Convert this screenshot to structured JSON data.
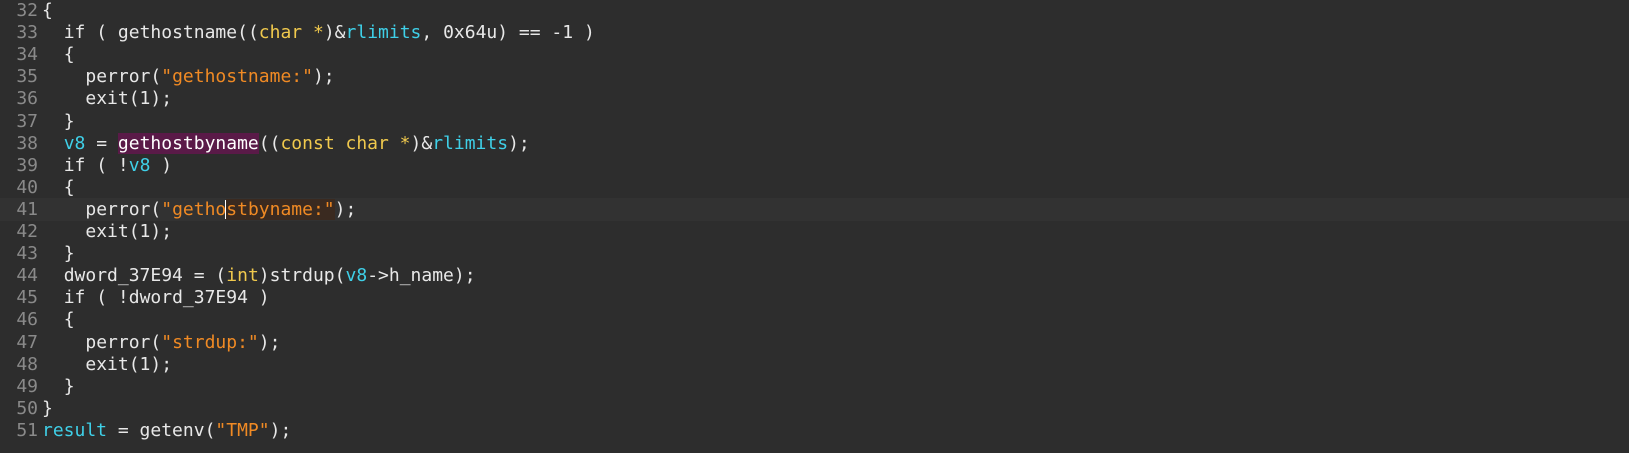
{
  "editor": {
    "lines": [
      {
        "num": "32",
        "indent": "",
        "parts": [
          {
            "t": "{",
            "c": "op"
          }
        ]
      },
      {
        "num": "33",
        "indent": "  ",
        "parts": [
          {
            "t": "if",
            "c": "kw"
          },
          {
            "t": " ( ",
            "c": "op"
          },
          {
            "t": "gethostname",
            "c": "fn"
          },
          {
            "t": "((",
            "c": "op"
          },
          {
            "t": "char *",
            "c": "type"
          },
          {
            "t": ")&",
            "c": "op"
          },
          {
            "t": "rlimits",
            "c": "var"
          },
          {
            "t": ", ",
            "c": "op"
          },
          {
            "t": "0x64u",
            "c": "num"
          },
          {
            "t": ") == -1 )",
            "c": "op"
          }
        ]
      },
      {
        "num": "34",
        "indent": "  ",
        "parts": [
          {
            "t": "{",
            "c": "op"
          }
        ]
      },
      {
        "num": "35",
        "indent": "    ",
        "parts": [
          {
            "t": "perror",
            "c": "fn"
          },
          {
            "t": "(",
            "c": "op"
          },
          {
            "t": "\"gethostname:\"",
            "c": "str"
          },
          {
            "t": ");",
            "c": "op"
          }
        ]
      },
      {
        "num": "36",
        "indent": "    ",
        "parts": [
          {
            "t": "exit",
            "c": "fn"
          },
          {
            "t": "(1);",
            "c": "op"
          }
        ]
      },
      {
        "num": "37",
        "indent": "  ",
        "parts": [
          {
            "t": "}",
            "c": "op"
          }
        ]
      },
      {
        "num": "38",
        "indent": "  ",
        "parts": [
          {
            "t": "v8",
            "c": "var"
          },
          {
            "t": " = ",
            "c": "op"
          },
          {
            "t": "gethostbyname",
            "c": "hl-fn"
          },
          {
            "t": "((",
            "c": "op"
          },
          {
            "t": "const char *",
            "c": "type"
          },
          {
            "t": ")&",
            "c": "op"
          },
          {
            "t": "rlimits",
            "c": "var"
          },
          {
            "t": ");",
            "c": "op"
          }
        ]
      },
      {
        "num": "39",
        "indent": "  ",
        "parts": [
          {
            "t": "if",
            "c": "kw"
          },
          {
            "t": " ( !",
            "c": "op"
          },
          {
            "t": "v8",
            "c": "var"
          },
          {
            "t": " )",
            "c": "op"
          }
        ]
      },
      {
        "num": "40",
        "indent": "  ",
        "parts": [
          {
            "t": "{",
            "c": "op"
          }
        ]
      },
      {
        "num": "41",
        "indent": "    ",
        "current": true,
        "parts": [
          {
            "t": "perror",
            "c": "fn"
          },
          {
            "t": "(",
            "c": "op"
          },
          {
            "t": "\"getho",
            "c": "str"
          },
          {
            "t": "",
            "c": "caret"
          },
          {
            "t": "stbyname:\"",
            "c": "str hl-str"
          },
          {
            "t": ");",
            "c": "op"
          }
        ]
      },
      {
        "num": "42",
        "indent": "    ",
        "parts": [
          {
            "t": "exit",
            "c": "fn"
          },
          {
            "t": "(1);",
            "c": "op"
          }
        ]
      },
      {
        "num": "43",
        "indent": "  ",
        "parts": [
          {
            "t": "}",
            "c": "op"
          }
        ]
      },
      {
        "num": "44",
        "indent": "  ",
        "parts": [
          {
            "t": "dword_37E94",
            "c": "fn"
          },
          {
            "t": " = (",
            "c": "op"
          },
          {
            "t": "int",
            "c": "type"
          },
          {
            "t": ")",
            "c": "op"
          },
          {
            "t": "strdup",
            "c": "fn"
          },
          {
            "t": "(",
            "c": "op"
          },
          {
            "t": "v8",
            "c": "var"
          },
          {
            "t": "->h_name);",
            "c": "op"
          }
        ]
      },
      {
        "num": "45",
        "indent": "  ",
        "parts": [
          {
            "t": "if",
            "c": "kw"
          },
          {
            "t": " ( !",
            "c": "op"
          },
          {
            "t": "dword_37E94",
            "c": "fn"
          },
          {
            "t": " )",
            "c": "op"
          }
        ]
      },
      {
        "num": "46",
        "indent": "  ",
        "parts": [
          {
            "t": "{",
            "c": "op"
          }
        ]
      },
      {
        "num": "47",
        "indent": "    ",
        "parts": [
          {
            "t": "perror",
            "c": "fn"
          },
          {
            "t": "(",
            "c": "op"
          },
          {
            "t": "\"strdup:\"",
            "c": "str"
          },
          {
            "t": ");",
            "c": "op"
          }
        ]
      },
      {
        "num": "48",
        "indent": "    ",
        "parts": [
          {
            "t": "exit",
            "c": "fn"
          },
          {
            "t": "(1);",
            "c": "op"
          }
        ]
      },
      {
        "num": "49",
        "indent": "  ",
        "parts": [
          {
            "t": "}",
            "c": "op"
          }
        ]
      },
      {
        "num": "50",
        "indent": "",
        "parts": [
          {
            "t": "}",
            "c": "op"
          }
        ]
      },
      {
        "num": "51",
        "indent": "",
        "parts": [
          {
            "t": "result",
            "c": "var"
          },
          {
            "t": " = ",
            "c": "op"
          },
          {
            "t": "getenv",
            "c": "fn"
          },
          {
            "t": "(",
            "c": "op"
          },
          {
            "t": "\"TMP\"",
            "c": "str"
          },
          {
            "t": ");",
            "c": "op"
          }
        ]
      }
    ],
    "colors": {
      "background": "#2d2d2d",
      "current_line": "#323232",
      "line_number": "#8a8a8a",
      "type": "#f0c94d",
      "variable": "#3fd0e8",
      "string": "#f08a24",
      "highlight": "#5a1a48"
    }
  }
}
